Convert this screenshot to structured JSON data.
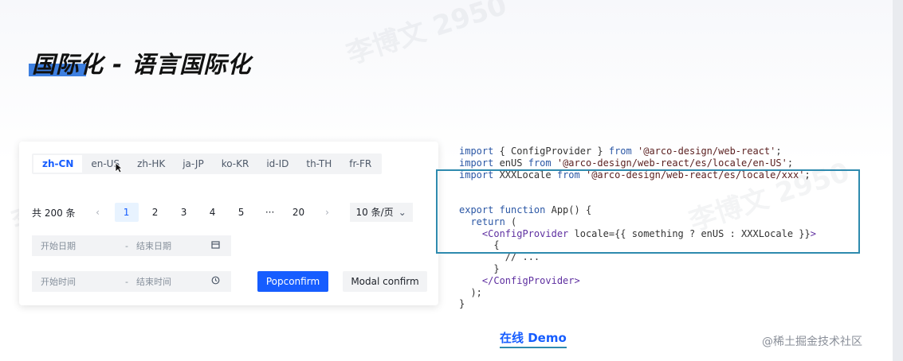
{
  "slide": {
    "title": "国际化 - 语言国际化",
    "demo_link": "在线 Demo",
    "credit": "@稀土掘金技术社区"
  },
  "demo": {
    "lang_tabs": [
      "zh-CN",
      "en-US",
      "zh-HK",
      "ja-JP",
      "ko-KR",
      "id-ID",
      "th-TH",
      "fr-FR"
    ],
    "active_lang": "zh-CN",
    "pagination": {
      "total_text": "共 200 条",
      "prev": "‹",
      "pages": [
        "1",
        "2",
        "3",
        "4",
        "5",
        "···",
        "20"
      ],
      "current": "1",
      "next": "›",
      "page_size": "10 条/页",
      "page_size_arrow": "⌄"
    },
    "date_range": {
      "start_placeholder": "开始日期",
      "separator": "-",
      "end_placeholder": "结束日期",
      "icon": "calendar-icon"
    },
    "time_range": {
      "start_placeholder": "开始时间",
      "separator": "-",
      "end_placeholder": "结束时间",
      "icon": "clock-icon"
    },
    "popconfirm_button": "Popconfirm",
    "modal_button": "Modal confirm"
  },
  "code": {
    "lines": [
      [
        [
          "kw",
          "import"
        ],
        [
          "t",
          " { ConfigProvider } "
        ],
        [
          "kw",
          "from"
        ],
        [
          "str",
          " '@arco-design/web-react'"
        ],
        [
          "t",
          ";"
        ]
      ],
      [
        [
          "kw",
          "import"
        ],
        [
          "t",
          " enUS "
        ],
        [
          "kw",
          "from"
        ],
        [
          "str",
          " '@arco-design/web-react/es/locale/en-US'"
        ],
        [
          "t",
          ";"
        ]
      ],
      [
        [
          "kw",
          "import"
        ],
        [
          "t",
          " XXXLocale "
        ],
        [
          "kw",
          "from"
        ],
        [
          "str",
          " '@arco-design/web-react/es/locale/xxx'"
        ],
        [
          "t",
          ";"
        ]
      ],
      [
        [
          "t",
          ""
        ]
      ],
      [
        [
          "t",
          ""
        ]
      ],
      [
        [
          "kw",
          "export function"
        ],
        [
          "t",
          " App() {"
        ]
      ],
      [
        [
          "kw",
          "  return"
        ],
        [
          "t",
          " ("
        ]
      ],
      [
        [
          "tag",
          "    <ConfigProvider"
        ],
        [
          "t",
          " locale={{ something ? enUS : XXXLocale }}"
        ],
        [
          "tag",
          ">"
        ]
      ],
      [
        [
          "t",
          "      {"
        ]
      ],
      [
        [
          "t",
          "        // ..."
        ]
      ],
      [
        [
          "t",
          "      }"
        ]
      ],
      [
        [
          "tag",
          "    </ConfigProvider>"
        ]
      ],
      [
        [
          "t",
          "  );"
        ]
      ],
      [
        [
          "t",
          "}"
        ]
      ]
    ]
  },
  "colors": {
    "accent": "#165dff",
    "title_bar": "#3d7fe0",
    "highlight_border": "#2e8aae"
  }
}
